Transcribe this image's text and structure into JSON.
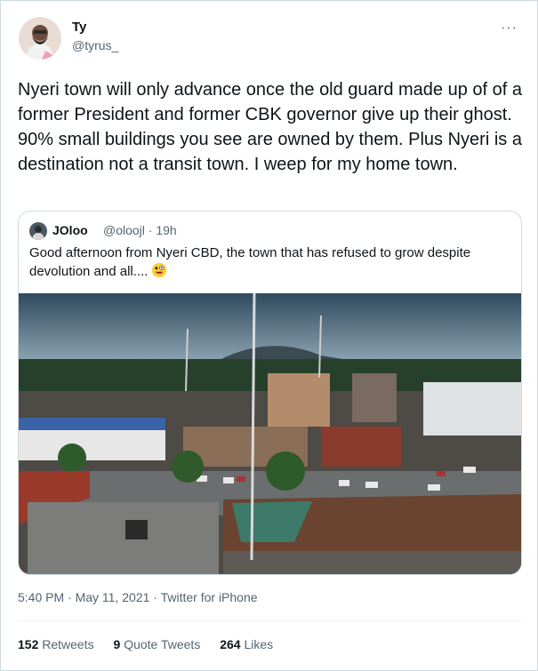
{
  "author": {
    "display_name": "Ty",
    "handle": "@tyrus_",
    "avatar_icon": "profile-photo",
    "more_icon": "more-options-icon",
    "more_glyph": "···"
  },
  "tweet": {
    "text": "Nyeri town will only advance once the old guard made up of of a former President and former CBK governor give up their ghost. 90% small buildings you see are owned by them. Plus Nyeri is a destination not a transit town. I weep for my home town."
  },
  "quote": {
    "display_name": "JOloo",
    "handle": "@oloojl",
    "time": "· 19h",
    "text": "Good afternoon from Nyeri CBD, the town that has refused to grow despite devolution and all....",
    "emoji_icon": "zany-face-emoji",
    "photo": "aerial-view-nyeri-town"
  },
  "meta": {
    "time": "5:40 PM",
    "sep": " · ",
    "date": "May 11, 2021",
    "source": "Twitter for iPhone"
  },
  "stats": {
    "retweets_count": "152",
    "retweets_label": "Retweets",
    "quotes_count": "9",
    "quotes_label": "Quote Tweets",
    "likes_count": "264",
    "likes_label": "Likes"
  },
  "colors": {
    "text": "#0f1419",
    "secondary": "#536471",
    "border": "#cfd9de"
  }
}
